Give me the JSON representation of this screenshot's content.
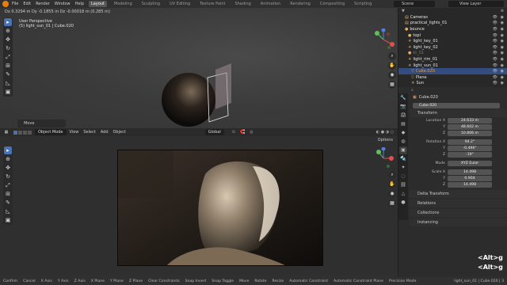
{
  "topbar": {
    "menus": [
      "File",
      "Edit",
      "Render",
      "Window",
      "Help"
    ],
    "workspaces": [
      "Layout",
      "Modeling",
      "Sculpting",
      "UV Editing",
      "Texture Paint",
      "Shading",
      "Animation",
      "Rendering",
      "Compositing",
      "Scripting"
    ],
    "active_workspace": "Layout",
    "scene": "Scene",
    "view_layer": "View Layer"
  },
  "viewport_top": {
    "status": "Dx 0.3294 m   Dy -0.1855 m   Dz -0.00018 m (0.285 m)",
    "perspective": "User Perspective",
    "collection": "(5) light_sun_01 | Cube.020",
    "operator_panel": "Move"
  },
  "viewport_bottom": {
    "mode": "Object Mode",
    "menus": [
      "View",
      "Select",
      "Add",
      "Object"
    ],
    "orientation": "Global",
    "options": "Options"
  },
  "outliner": {
    "rows": [
      {
        "label": "Cameras",
        "color": "#e8e8e8"
      },
      {
        "label": "practical_lights_01",
        "color": "#e8e8e8"
      },
      {
        "label": "bounce",
        "color": "#e8e8e8"
      },
      {
        "label": "topl",
        "color": "#e8e8e8"
      },
      {
        "label": "light_key_01",
        "color": "#e8e8e8"
      },
      {
        "label": "light_key_02",
        "color": "#e8e8e8"
      },
      {
        "label": "kt_01",
        "color": "#777777"
      },
      {
        "label": "light_rim_01",
        "color": "#e8e8e8"
      },
      {
        "label": "light_sun_01",
        "color": "#e8e8e8"
      },
      {
        "label": "Cube.020",
        "color": "#f0a040"
      },
      {
        "label": "Plane",
        "color": "#e8e8e8"
      },
      {
        "label": "Sun",
        "color": "#e8e8e8"
      },
      {
        "label": "Tree",
        "color": "#e8e8e8"
      }
    ]
  },
  "properties": {
    "object_name": "Cube.020",
    "object_field": "Cube.020",
    "transform_header": "Transform",
    "location_label": "Location X",
    "location": [
      "24.633 m",
      "48.602 m",
      "10.806 m"
    ],
    "rotation_label": "Rotation X",
    "rotation": [
      "94.2°",
      "-0.496°",
      "-19°"
    ],
    "mode_label": "Mode",
    "mode_value": "XYZ Euler",
    "scale_label": "Scale X",
    "scale": [
      "14.498",
      "0.904",
      "14.498"
    ],
    "y_label": "Y",
    "z_label": "Z",
    "delta": "Delta Transform",
    "relations": "Relations",
    "collections": "Collections",
    "instancing": "Instancing"
  },
  "overlay": {
    "hotkey1": "<Alt>g",
    "hotkey2": "<Alt>g"
  },
  "footer": {
    "items": [
      "Confirm",
      "Cancel",
      "X Axis",
      "Y Axis",
      "Z Axis",
      "X Plane",
      "Y Plane",
      "Z Plane",
      "Clear Constraints",
      "Snap Invert",
      "Snap Toggle",
      "Move",
      "Rotate",
      "Resize",
      "Automatic Constraint",
      "Automatic Constraint Plane",
      "Precision Mode"
    ],
    "right": "light_sun_01 | Cube.020 | 3"
  },
  "colors": {
    "accent": "#4772b3",
    "brand": "#e87d0d",
    "selected_object": "#f0a040"
  }
}
